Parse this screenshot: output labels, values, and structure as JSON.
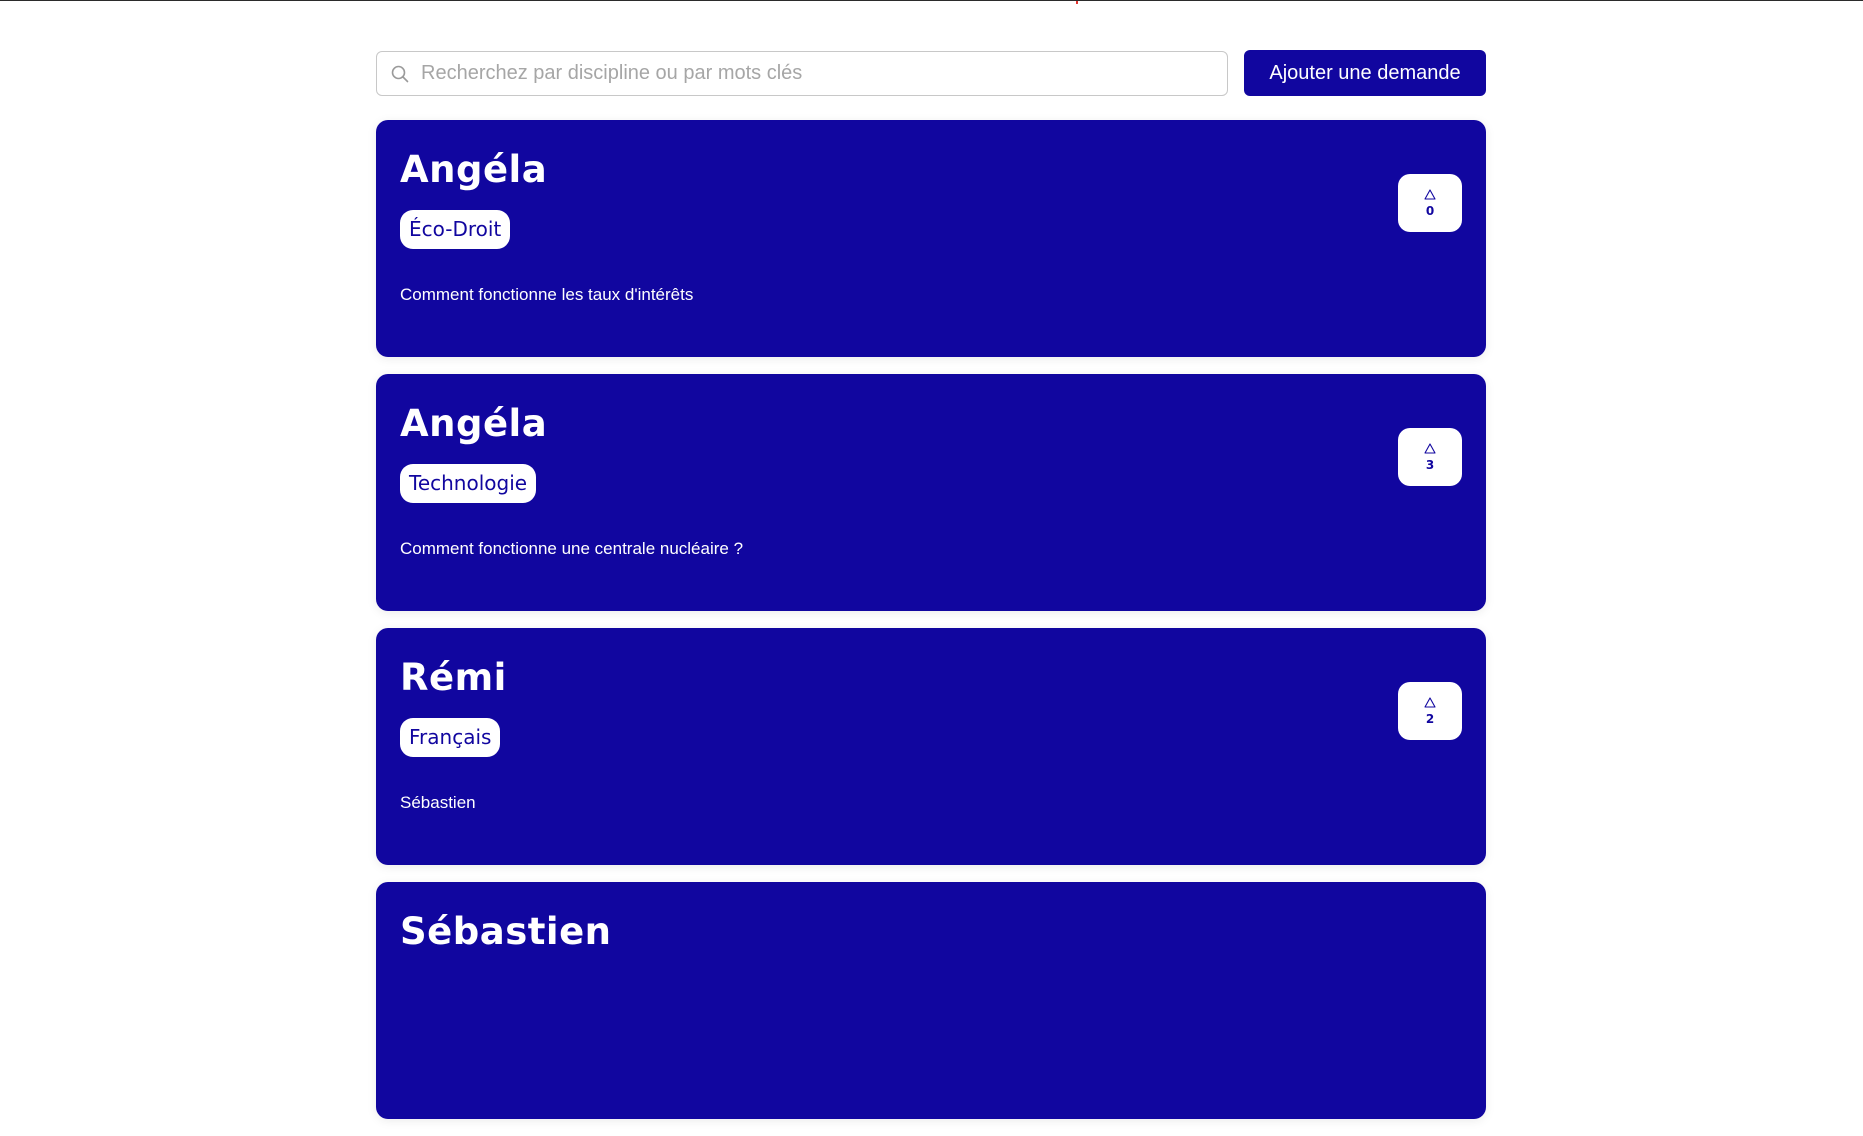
{
  "colors": {
    "accent": "#11069f",
    "card_text": "#ffffff",
    "marker": "#e3342f"
  },
  "search": {
    "placeholder": "Recherchez par discipline ou par mots clés",
    "value": "",
    "icon": "search-icon"
  },
  "toolbar": {
    "add_label": "Ajouter une demande"
  },
  "cards": [
    {
      "name": "Angéla",
      "tag": "Éco-Droit",
      "question": "Comment fonctionne les taux d'intérêts",
      "votes": "0",
      "vote_icon": "triangle-up-icon"
    },
    {
      "name": "Angéla",
      "tag": "Technologie",
      "question": "Comment fonctionne une centrale nucléaire ?",
      "votes": "3",
      "vote_icon": "triangle-up-icon"
    },
    {
      "name": "Rémi",
      "tag": "Français",
      "question": "Sébastien",
      "votes": "2",
      "vote_icon": "triangle-up-icon"
    },
    {
      "name": "Sébastien",
      "tag": "",
      "question": "",
      "votes": "",
      "vote_icon": "triangle-up-icon"
    }
  ]
}
